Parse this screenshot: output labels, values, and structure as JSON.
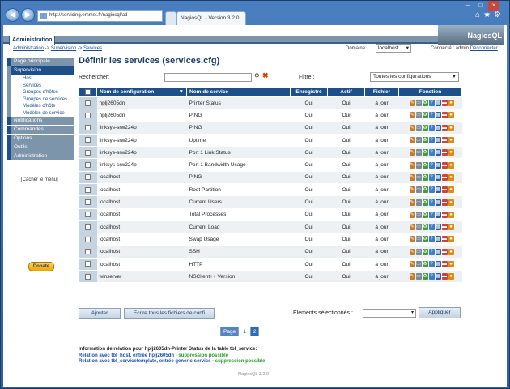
{
  "browser": {
    "url": "http://servicing.emmet.fr/nagiosql/ad",
    "tab_title": "NagiosQL - Version 3.2.0",
    "back_icon": "back-arrow-icon",
    "forward_icon": "forward-arrow-icon",
    "tools_icons": [
      "home-icon",
      "star-icon",
      "gear-icon"
    ]
  },
  "header": {
    "section_label": "Administration",
    "logo_text": "NagiosQL",
    "breadcrumb": [
      "Administration",
      "Supervision",
      "Services"
    ],
    "domain_label": "Domaine",
    "domain_value": "localhost",
    "connection_prefix": "Connecté : admin",
    "logout_label": "Déconnecter"
  },
  "sidebar": {
    "sections": [
      {
        "label": "Page principale",
        "selected": false,
        "items": []
      },
      {
        "label": "Supervision",
        "selected": true,
        "items": [
          "Host",
          "Services",
          "Groupes d'hôtes",
          "Groupes de services",
          "Modèles d'hôte",
          "Modèles de service"
        ]
      },
      {
        "label": "Notifications",
        "selected": false,
        "items": []
      },
      {
        "label": "Commandes",
        "selected": false,
        "items": []
      },
      {
        "label": "Options",
        "selected": false,
        "items": []
      },
      {
        "label": "Outils",
        "selected": false,
        "items": []
      },
      {
        "label": "Administration",
        "selected": false,
        "items": []
      }
    ],
    "hide_menu": "[Cacher le menu]",
    "donate": "Donate"
  },
  "main": {
    "title": "Définir les services (services.cfg)",
    "search_label": "Rechercher:",
    "search_value": "",
    "filter_label": "Filtre :",
    "filter_value": "Toutes les configurations",
    "columns": [
      "Nom de configuration",
      "Nom de service",
      "Enregistré",
      "Actif",
      "Fichier",
      "Fonction"
    ],
    "rows": [
      {
        "config": "hplj2605dn",
        "service": "Printer Status",
        "registered": "Oui",
        "active": "Oui",
        "file": "à jour"
      },
      {
        "config": "hplj2605dn",
        "service": "PING",
        "registered": "Oui",
        "active": "Oui",
        "file": "à jour"
      },
      {
        "config": "linksys-srw224p",
        "service": "PING",
        "registered": "Oui",
        "active": "Oui",
        "file": "à jour"
      },
      {
        "config": "linksys-srw224p",
        "service": "Uptime",
        "registered": "Oui",
        "active": "Oui",
        "file": "à jour"
      },
      {
        "config": "linksys-srw224p",
        "service": "Port 1 Link Status",
        "registered": "Oui",
        "active": "Oui",
        "file": "à jour"
      },
      {
        "config": "linksys-srw224p",
        "service": "Port 1 Bandwidth Usage",
        "registered": "Oui",
        "active": "Oui",
        "file": "à jour"
      },
      {
        "config": "localhost",
        "service": "PING",
        "registered": "Oui",
        "active": "Oui",
        "file": "à jour"
      },
      {
        "config": "localhost",
        "service": "Root Partition",
        "registered": "Oui",
        "active": "Oui",
        "file": "à jour"
      },
      {
        "config": "localhost",
        "service": "Current Users",
        "registered": "Oui",
        "active": "Oui",
        "file": "à jour"
      },
      {
        "config": "localhost",
        "service": "Total Processes",
        "registered": "Oui",
        "active": "Oui",
        "file": "à jour"
      },
      {
        "config": "localhost",
        "service": "Current Load",
        "registered": "Oui",
        "active": "Oui",
        "file": "à jour"
      },
      {
        "config": "localhost",
        "service": "Swap Usage",
        "registered": "Oui",
        "active": "Oui",
        "file": "à jour"
      },
      {
        "config": "localhost",
        "service": "SSH",
        "registered": "Oui",
        "active": "Oui",
        "file": "à jour"
      },
      {
        "config": "localhost",
        "service": "HTTP",
        "registered": "Oui",
        "active": "Oui",
        "file": "à jour"
      },
      {
        "config": "winserver",
        "service": "NSClient++ Version",
        "registered": "Oui",
        "active": "Oui",
        "file": "à jour"
      }
    ],
    "function_icons": [
      "edit-icon",
      "copy-icon",
      "delete-icon",
      "info-icon",
      "config-icon",
      "display-icon",
      "status-icon"
    ],
    "add_button": "Ajouter",
    "write_button": "Ecrire tous les fichiers de confi",
    "selected_label": "Éléments sélectionnés :",
    "apply_button": "Appliquer",
    "pager": {
      "label": "Page",
      "pages": [
        "1",
        "2"
      ],
      "current": "1"
    }
  },
  "relation_info": {
    "title": "Information de relation pour hplj2605dn-Printer Status de la table tbl_service:",
    "line1_prefix": "Relation avec tbl_host, entrée hplj2605dn",
    "line1_suffix": " - suppression possible",
    "line2_prefix": "Relation avec tbl_servicetemplate, entrée generic-service",
    "line2_suffix": " - suppression possible"
  },
  "footer": "NagiosQL 3.2.0",
  "colors": {
    "accent": "#1d4f8b",
    "ok": "#2a9d2a"
  }
}
